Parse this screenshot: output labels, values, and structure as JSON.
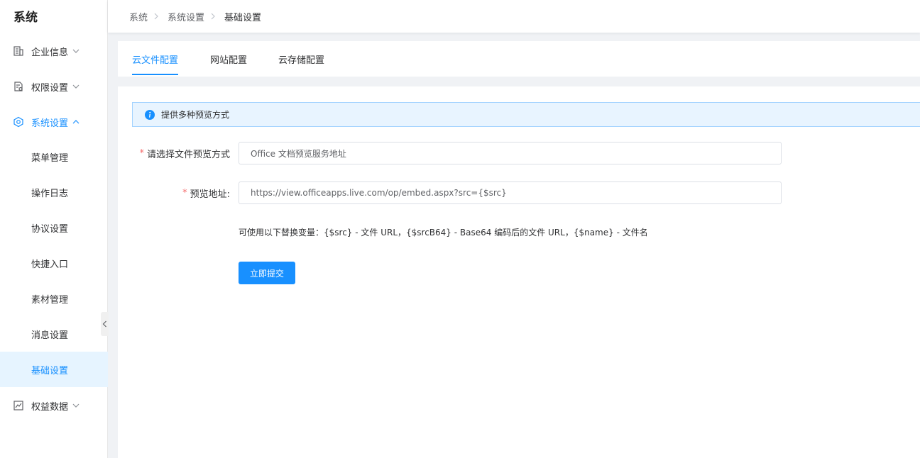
{
  "sidebar": {
    "title": "系统",
    "menus": [
      {
        "label": "企业信息",
        "icon": "building-icon"
      },
      {
        "label": "权限设置",
        "icon": "permission-doc-icon"
      },
      {
        "label": "系统设置",
        "icon": "settings-hex-icon",
        "expanded": true
      },
      {
        "label": "权益数据",
        "icon": "chart-line-icon"
      }
    ],
    "sub_items": [
      {
        "label": "菜单管理"
      },
      {
        "label": "操作日志"
      },
      {
        "label": "协议设置"
      },
      {
        "label": "快捷入口"
      },
      {
        "label": "素材管理"
      },
      {
        "label": "消息设置"
      },
      {
        "label": "基础设置",
        "active": true
      }
    ]
  },
  "breadcrumb": {
    "items": [
      "系统",
      "系统设置",
      "基础设置"
    ]
  },
  "tabs": [
    {
      "label": "云文件配置",
      "active": true
    },
    {
      "label": "网站配置"
    },
    {
      "label": "云存储配置"
    }
  ],
  "form": {
    "alert": "提供多种预览方式",
    "preview_mode_label": "请选择文件预览方式",
    "preview_mode_value": "Office 文档预览服务地址",
    "preview_url_label": "预览地址:",
    "preview_url_value": "https://view.officeapps.live.com/op/embed.aspx?src={$src}",
    "hint": "可使用以下替换变量：{$src} - 文件 URL，{$srcB64} - Base64 编码后的文件 URL，{$name} - 文件名",
    "submit_label": "立即提交"
  },
  "colors": {
    "accent": "#1890ff",
    "required": "#f56c6c",
    "alert_bg": "#e8f4ff"
  }
}
